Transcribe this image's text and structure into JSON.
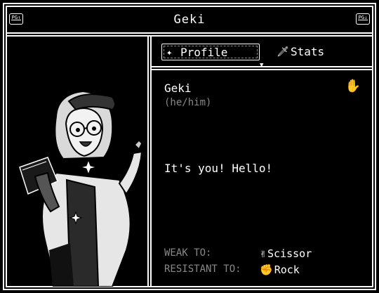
{
  "window": {
    "title": "Geki",
    "left_button_label": "PG↑",
    "right_button_label": "PG↓"
  },
  "tabs": [
    {
      "label": "Profile",
      "icon": "sparkle-icon",
      "selected": true
    },
    {
      "label": "Stats",
      "icon": "sword-icon",
      "selected": false
    }
  ],
  "profile": {
    "name": "Geki",
    "pronouns": "(he/him)",
    "hand_icon": "paper-hand-icon",
    "greeting": "It's you! Hello!",
    "weak_label": "WEAK TO:",
    "weak_value": "Scissor",
    "weak_icon": "scissor-hand-icon",
    "resistant_label": "RESISTANT TO:",
    "resistant_value": "Rock",
    "resistant_icon": "rock-fist-icon"
  },
  "colors": {
    "background": "#000000",
    "foreground": "#ffffff",
    "muted": "#888888"
  }
}
